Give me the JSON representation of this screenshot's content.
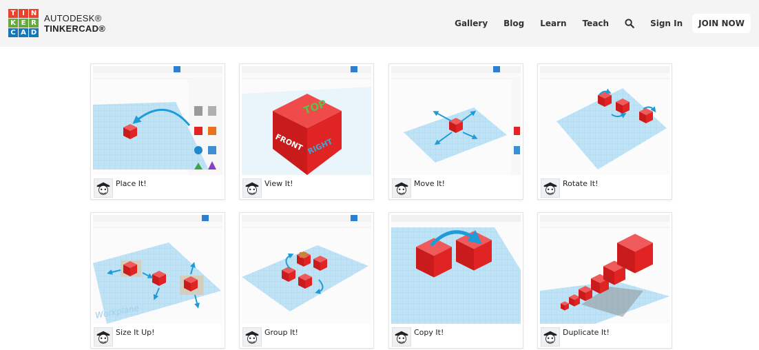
{
  "brand": {
    "logo_letters": [
      "T",
      "I",
      "N",
      "K",
      "E",
      "R",
      "C",
      "A",
      "D"
    ],
    "logo_colors": [
      "#e8412c",
      "#e8412c",
      "#e8412c",
      "#68a93e",
      "#68a93e",
      "#68a93e",
      "#1576b9",
      "#1576b9",
      "#1576b9"
    ],
    "line1": "AUTODESK®",
    "line2": "TINKERCAD®"
  },
  "nav": {
    "items": [
      "Gallery",
      "Blog",
      "Learn",
      "Teach"
    ],
    "search_icon": "search-icon",
    "sign_in": "Sign In",
    "join": "JOIN NOW"
  },
  "lessons": [
    {
      "title": "Place It!"
    },
    {
      "title": "View It!"
    },
    {
      "title": "Move It!"
    },
    {
      "title": "Rotate It!"
    },
    {
      "title": "Size It Up!"
    },
    {
      "title": "Group It!"
    },
    {
      "title": "Copy It!"
    },
    {
      "title": "Duplicate It!"
    }
  ],
  "view_cube_labels": {
    "top": "TOP",
    "front": "FRONT",
    "right": "RIGHT"
  },
  "workplane_label": "Workplane",
  "colors": {
    "cube_red": "#e02424",
    "workplane_blue": "#bfe3f5",
    "arrow_blue": "#1f9bd7"
  }
}
